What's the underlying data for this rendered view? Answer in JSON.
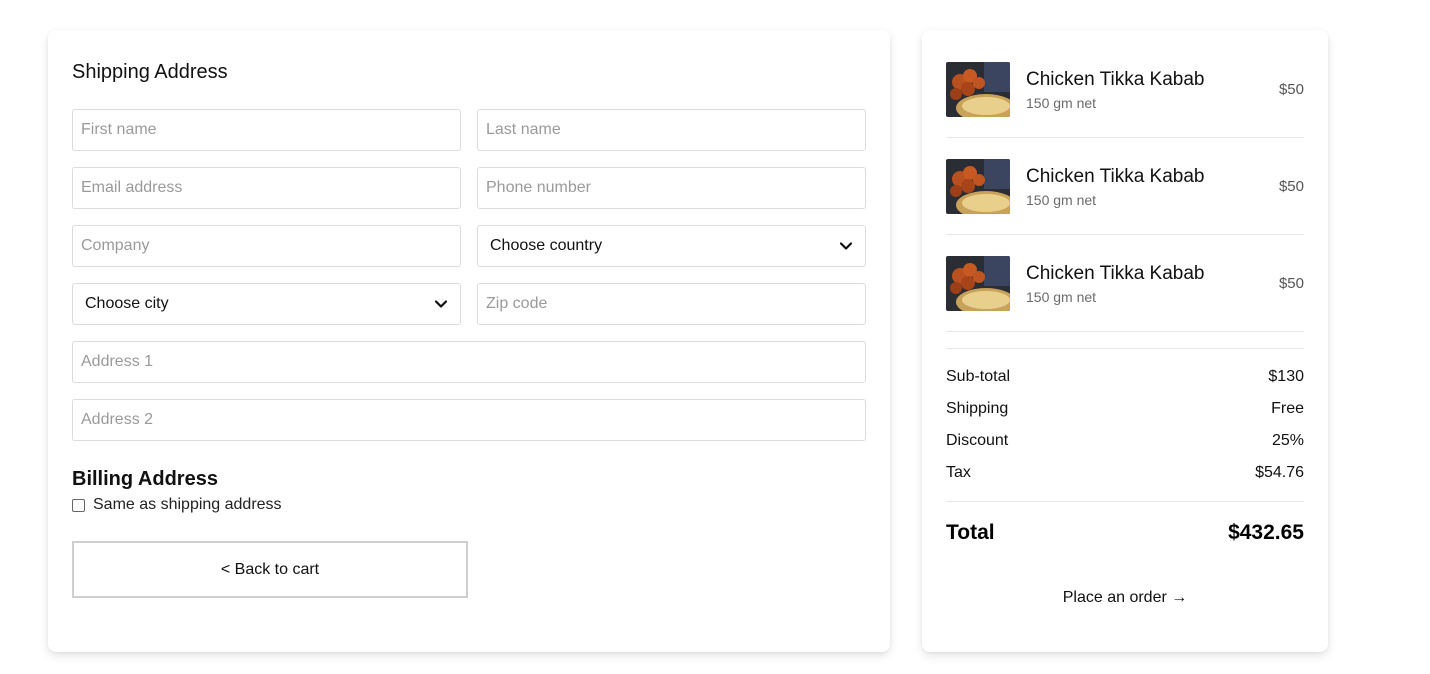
{
  "shipping": {
    "title": "Shipping Address",
    "first_name_placeholder": "First name",
    "last_name_placeholder": "Last name",
    "email_placeholder": "Email address",
    "phone_placeholder": "Phone number",
    "company_placeholder": "Company",
    "country_select": "Choose country",
    "city_select": "Choose city",
    "zip_placeholder": "Zip code",
    "address1_placeholder": "Address 1",
    "address2_placeholder": "Address 2"
  },
  "billing": {
    "title": "Billing Address",
    "same_label": "Same as shipping address",
    "same_checked": false
  },
  "actions": {
    "back_label": "< Back to cart",
    "order_label": "Place an order →"
  },
  "cart": {
    "items": [
      {
        "name": "Chicken Tikka Kabab",
        "weight": "150 gm net",
        "price": "$50"
      },
      {
        "name": "Chicken Tikka Kabab",
        "weight": "150 gm net",
        "price": "$50"
      },
      {
        "name": "Chicken Tikka Kabab",
        "weight": "150 gm net",
        "price": "$50"
      }
    ]
  },
  "summary": {
    "subtotal_label": "Sub-total",
    "subtotal_value": "$130",
    "shipping_label": "Shipping",
    "shipping_value": "Free",
    "discount_label": "Discount",
    "discount_value": "25%",
    "tax_label": "Tax",
    "tax_value": "$54.76",
    "total_label": "Total",
    "total_value": "$432.65"
  }
}
